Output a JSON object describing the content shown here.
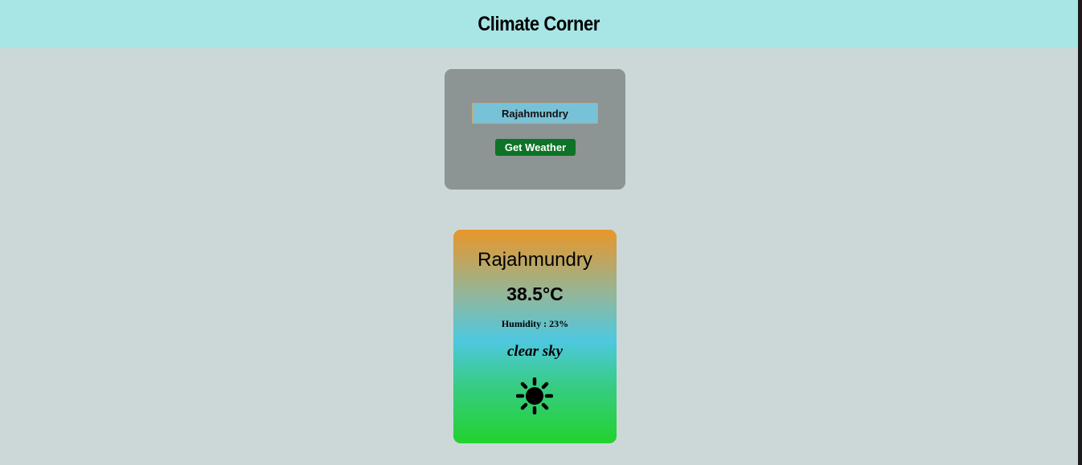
{
  "header": {
    "title": "Climate Corner"
  },
  "search": {
    "city_value": "Rajahmundry",
    "button_label": "Get Weather"
  },
  "weather": {
    "city": "Rajahmundry",
    "temperature": "38.5°C",
    "humidity": "Humidity : 23%",
    "description": "clear sky",
    "icon": "sun-icon"
  },
  "colors": {
    "header_bg": "#a8e6e6",
    "page_bg": "#ccd8d8",
    "search_box_bg": "#8c9494",
    "input_bg": "#78c2d8",
    "button_bg": "#0d7326",
    "card_gradient_top": "#e8962a",
    "card_gradient_mid": "#4ec8e0",
    "card_gradient_bottom": "#22d22e"
  }
}
